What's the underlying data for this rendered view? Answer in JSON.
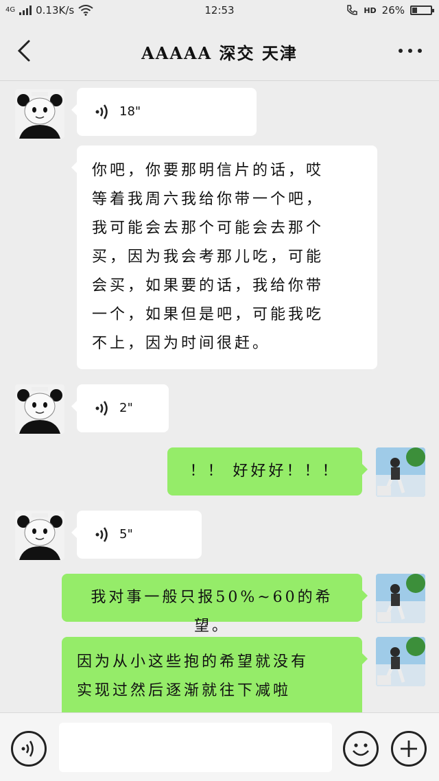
{
  "status_bar": {
    "network": "4G",
    "speed": "0.13K/s",
    "time": "12:53",
    "hd": "HD",
    "battery": "26%",
    "battery_level": 0.26
  },
  "header": {
    "title": "AAAAA 深交 天津",
    "back_icon": "chevron-left-icon",
    "more_icon": "more-dots-icon"
  },
  "messages": [
    {
      "side": "in",
      "type": "voice",
      "duration": "18\""
    },
    {
      "side": "in",
      "type": "text",
      "lines": [
        "你吧，你要那明信片的话，哎",
        "等着我周六我给你带一个吧，",
        "我可能会去那个可能会去那个",
        "买，因为我会考那儿吃，可能",
        "会买，如果要的话，我给你带",
        "一个，如果但是吧，可能我吃",
        "不上，因为时间很赶。"
      ]
    },
    {
      "side": "in",
      "type": "voice",
      "duration": "2\""
    },
    {
      "side": "out",
      "type": "text",
      "text": "！！ 好好好！！！"
    },
    {
      "side": "in",
      "type": "voice",
      "duration": "5\""
    },
    {
      "side": "out",
      "type": "text",
      "text": "我对事一般只报50%~60的希望。"
    },
    {
      "side": "out",
      "type": "text",
      "lines": [
        "因为从小这些抱的希望就没有",
        "实现过然后逐渐就往下减啦"
      ]
    }
  ],
  "colors": {
    "background": "#ededed",
    "incoming_bubble": "#ffffff",
    "outgoing_bubble": "#95ec69"
  },
  "input_bar": {
    "voice_icon": "voice-toggle-icon",
    "input_value": "",
    "emoji_icon": "emoji-icon",
    "plus_icon": "plus-icon"
  }
}
